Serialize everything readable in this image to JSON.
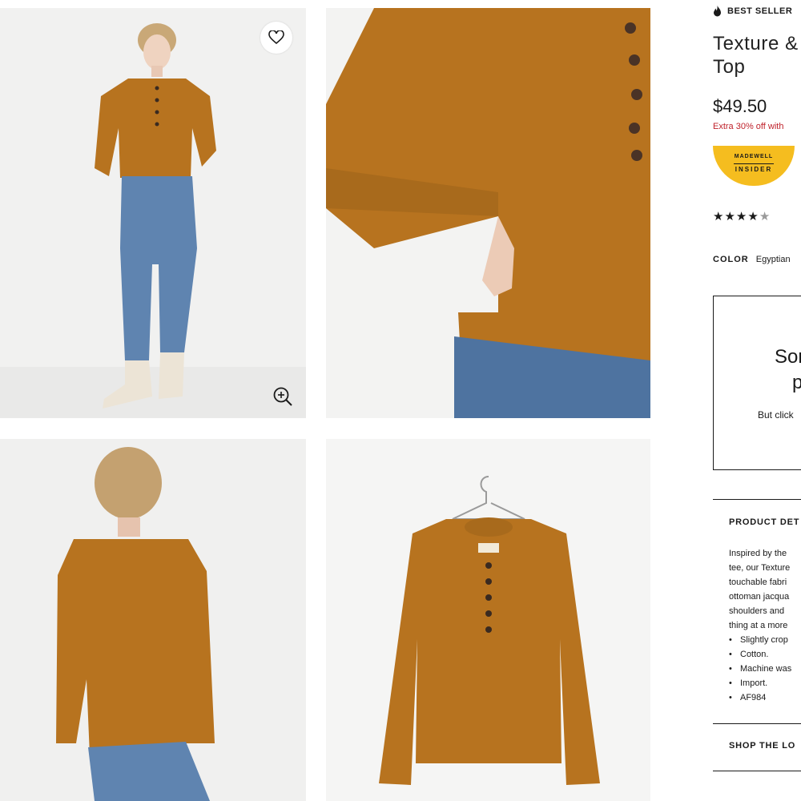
{
  "product": {
    "badge": "BEST SELLER",
    "title_line1": "Texture &",
    "title_line2": "Top",
    "price": "$49.50",
    "promo": "Extra 30% off with",
    "insider_top": "MADEWELL",
    "insider_bottom": "INSIDER",
    "rating_stars": 4,
    "rating_max": 5,
    "color_label": "COLOR",
    "color_value": "Egyptian"
  },
  "notice": {
    "heading_line1": "Sor",
    "heading_line2": "p",
    "body": "But click"
  },
  "details": {
    "title": "PRODUCT DET",
    "paragraph_lines": [
      "Inspired by the",
      "tee, our Texture",
      "touchable fabri",
      "ottoman jacqua",
      "shoulders and",
      "thing at a more"
    ],
    "bullets": [
      "Slightly crop",
      "Cotton.",
      "Machine was",
      "Import.",
      "AF984"
    ]
  },
  "shop_the_look": {
    "title": "SHOP THE LO"
  },
  "icons": {
    "wishlist": "heart-icon",
    "zoom": "zoom-in-icon",
    "badge": "flame-icon"
  },
  "colors": {
    "sweater": "#b7731f",
    "promo_red": "#c0232c",
    "insider_yellow": "#f5bd1f",
    "denim": "#5f84b0"
  }
}
